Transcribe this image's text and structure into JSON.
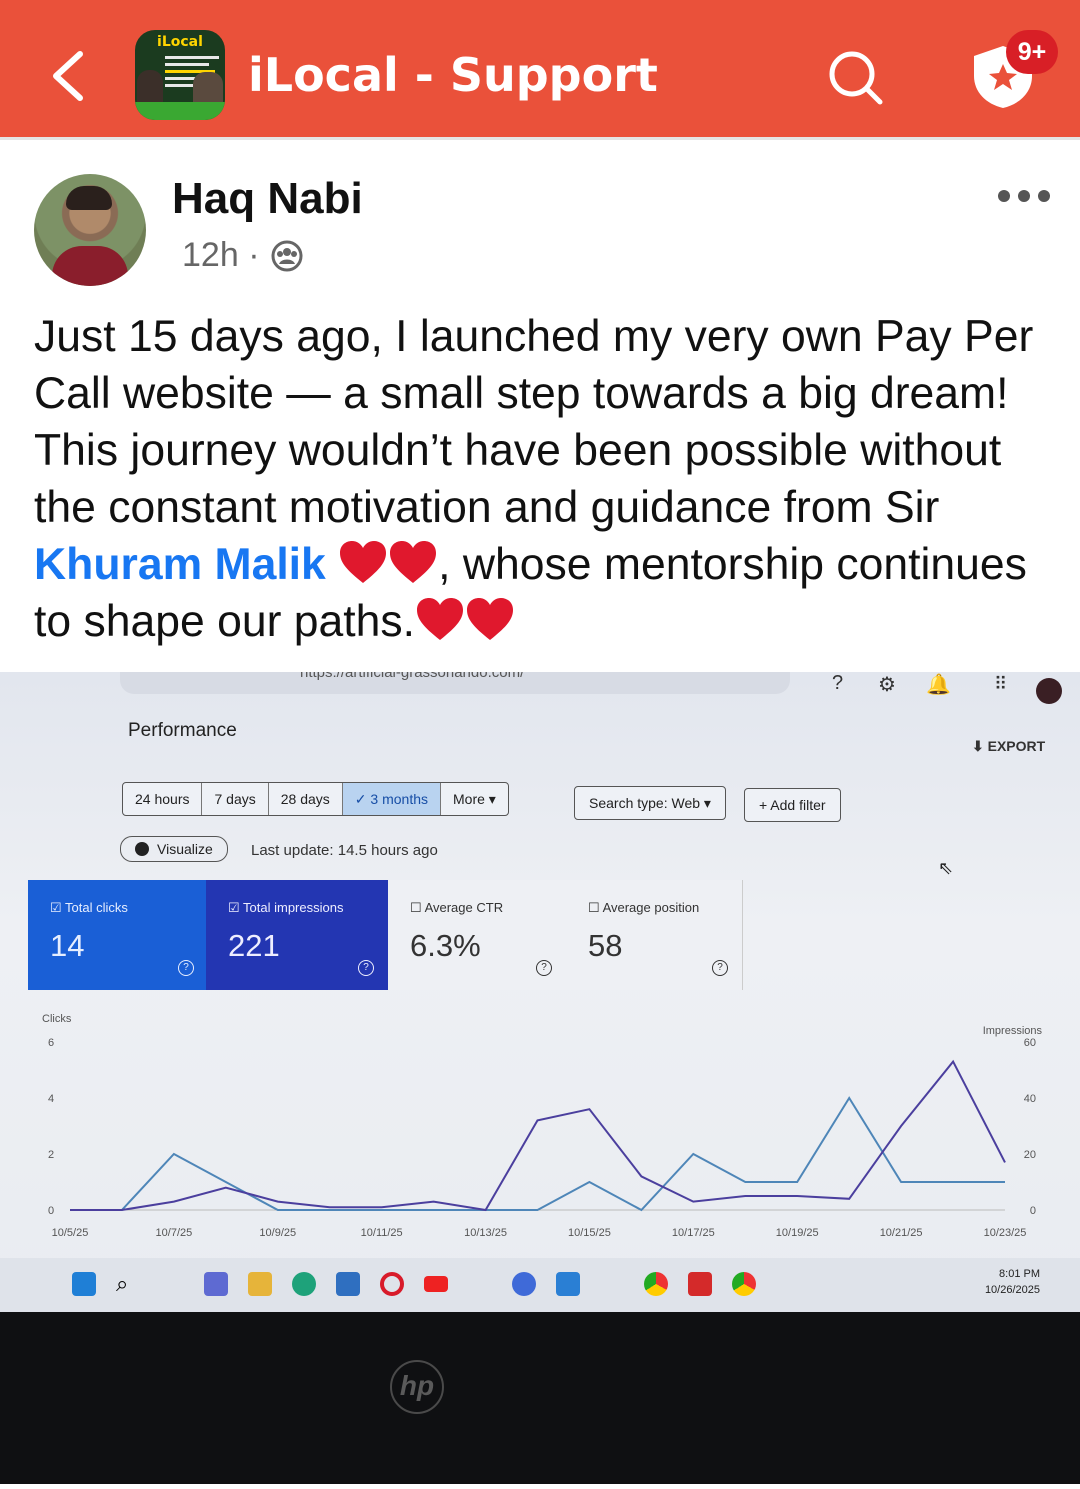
{
  "app": {
    "title": "iLocal - Support",
    "notification_count": "9+",
    "group_icon_logo": "iLocal",
    "accent_color": "#ea513a"
  },
  "post": {
    "author": "Haq Nabi",
    "time": "12h",
    "dot": "·",
    "privacy_icon": "group-icon",
    "text_1": "Just 15 days ago, I launched my very own Pay Per Call website — a small step towards a big dream! This journey wouldn’t have been possible without the constant motivation and guidance from Sir ",
    "mention": "Khuram Malik",
    "text_2": ", whose mentorship continues to shape our paths."
  },
  "gsc": {
    "url_fragment": "https://artificial-grassorlando.com/",
    "page_title": "Performance",
    "export_label": "EXPORT",
    "ranges": [
      "24 hours",
      "7 days",
      "28 days",
      "3 months",
      "More"
    ],
    "selected_range": "3 months",
    "search_type": "Search type: Web",
    "add_filter": "Add filter",
    "visualize": "Visualize",
    "last_update": "Last update: 14.5 hours ago",
    "metrics": [
      {
        "label": "Total clicks",
        "value": "14",
        "checked": true
      },
      {
        "label": "Total impressions",
        "value": "221",
        "checked": true
      },
      {
        "label": "Average CTR",
        "value": "6.3%",
        "checked": false
      },
      {
        "label": "Average position",
        "value": "58",
        "checked": false
      }
    ],
    "clock_time": "8:01 PM",
    "clock_date": "10/26/2025",
    "brand": "hp"
  },
  "chart_data": {
    "type": "line",
    "x": [
      "10/5/25",
      "10/6/25",
      "10/7/25",
      "10/8/25",
      "10/9/25",
      "10/10/25",
      "10/11/25",
      "10/12/25",
      "10/13/25",
      "10/14/25",
      "10/15/25",
      "10/16/25",
      "10/17/25",
      "10/18/25",
      "10/19/25",
      "10/20/25",
      "10/21/25",
      "10/22/25",
      "10/23/25"
    ],
    "x_tick_labels": [
      "10/5/25",
      "10/7/25",
      "10/9/25",
      "10/11/25",
      "10/13/25",
      "10/15/25",
      "10/17/25",
      "10/19/25",
      "10/21/25",
      "10/23/25"
    ],
    "series": [
      {
        "name": "Clicks",
        "axis": "left",
        "color": "#4e86b8",
        "values": [
          0,
          0,
          2,
          1,
          0,
          0,
          0,
          0,
          0,
          0,
          1,
          0,
          2,
          1,
          1,
          4,
          1,
          1,
          1
        ]
      },
      {
        "name": "Impressions",
        "axis": "right",
        "color": "#4b3f9e",
        "values": [
          0,
          0,
          3,
          8,
          3,
          1,
          1,
          3,
          0,
          32,
          36,
          12,
          3,
          5,
          5,
          4,
          30,
          53,
          17
        ]
      }
    ],
    "ylabel_left": "Clicks",
    "ylabel_right": "Impressions",
    "ylim_left": [
      0,
      6
    ],
    "yticks_left": [
      "0",
      "2",
      "4",
      "6"
    ],
    "ylim_right": [
      0,
      60
    ],
    "yticks_right": [
      "0",
      "20",
      "40",
      "60"
    ]
  }
}
